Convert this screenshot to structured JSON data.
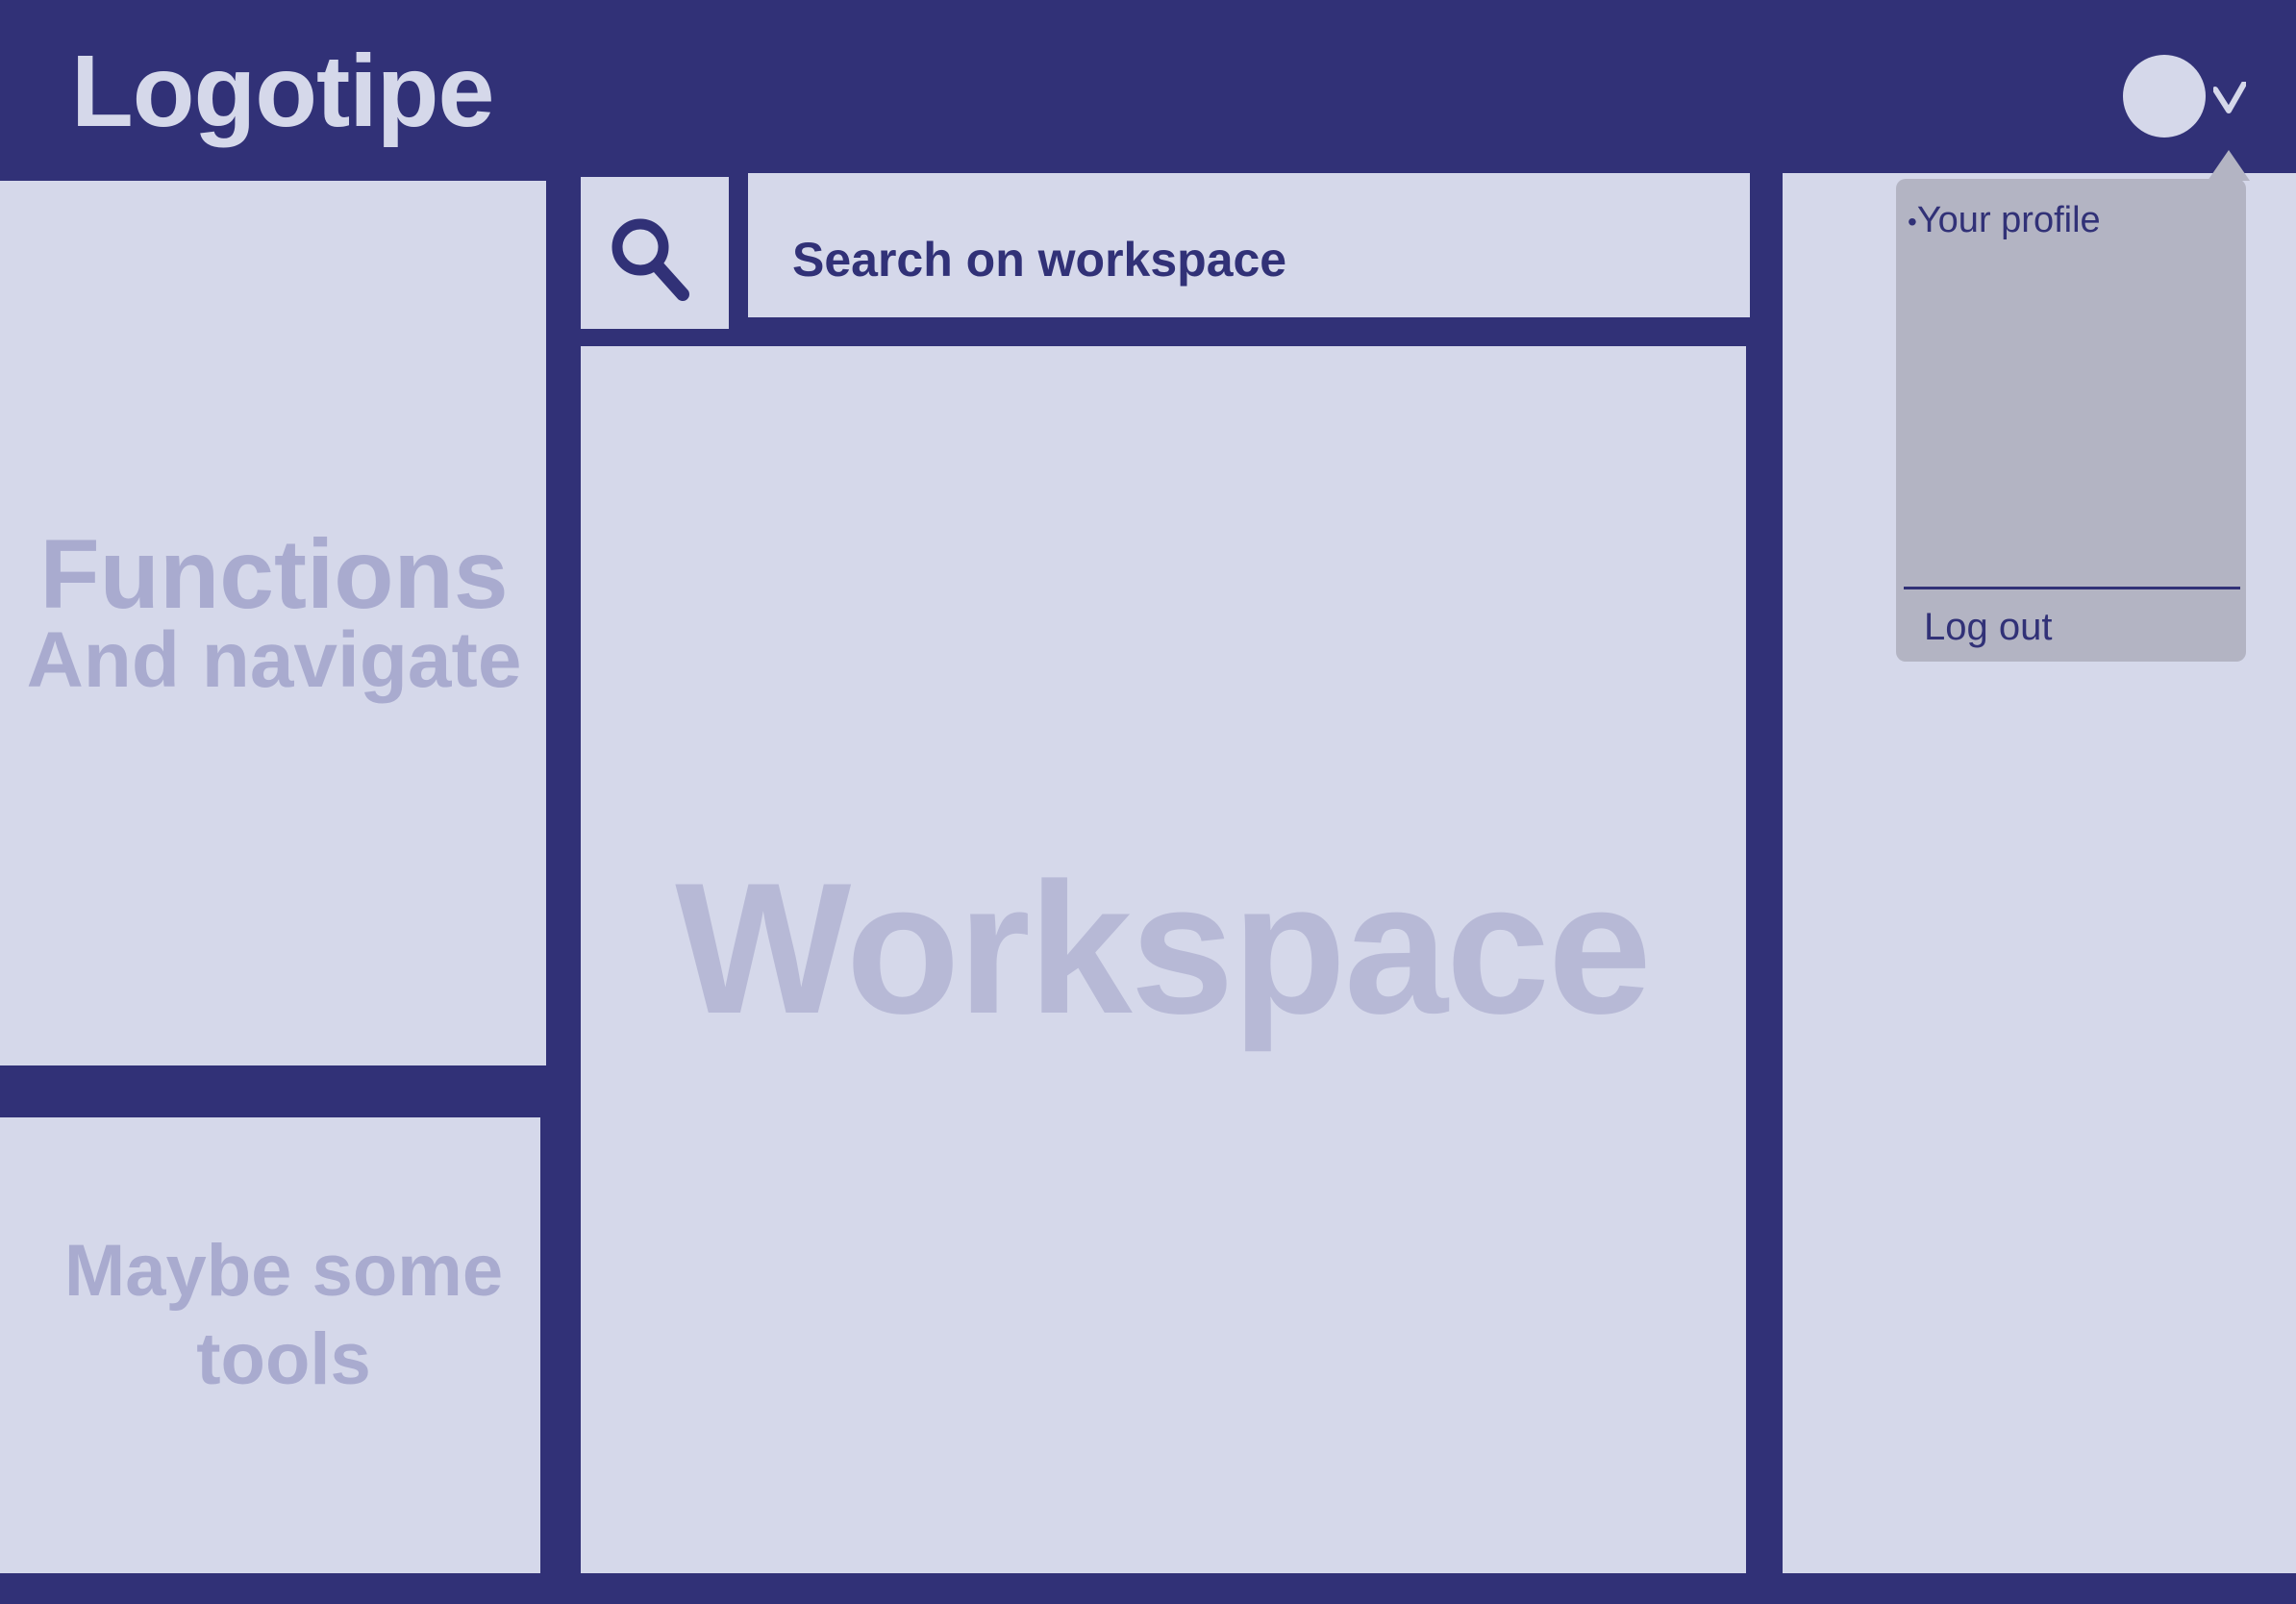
{
  "header": {
    "logo": "Logotipe"
  },
  "sidebar": {
    "title": "Functions",
    "subtitle": "And navigate"
  },
  "tools": {
    "line1": "Maybe some",
    "line2": "tools"
  },
  "search": {
    "label": "Search on workspace",
    "icon": "search-icon"
  },
  "workspace": {
    "label": "Workspace"
  },
  "user_menu": {
    "avatar": "avatar",
    "chevron": "chevron-down-icon",
    "bullet": "•",
    "items": [
      {
        "label": "Your profile"
      },
      {
        "label": "Log out"
      }
    ]
  },
  "colors": {
    "frame": "#313177",
    "panel": "#d5d8ea",
    "muted_text": "#a9abcf",
    "dropdown": "#b3b4c3"
  }
}
